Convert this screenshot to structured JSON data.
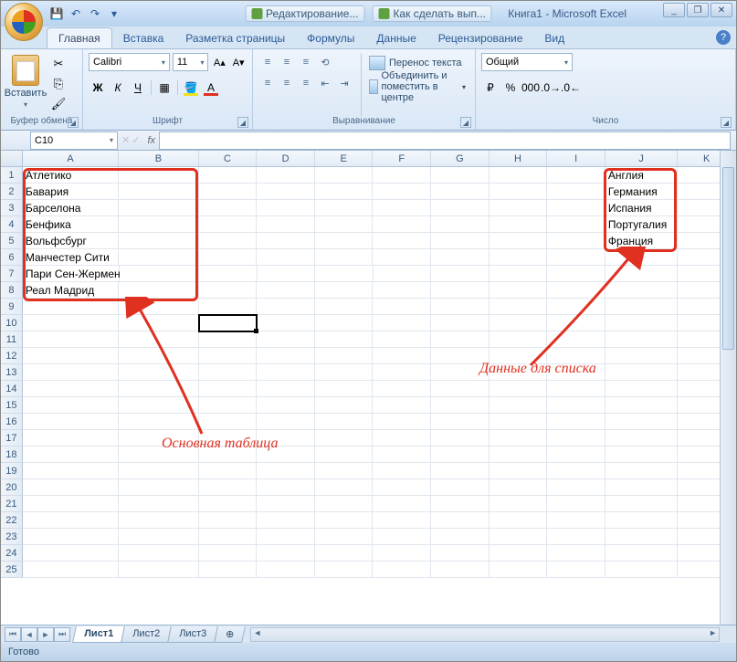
{
  "app_title": "Книга1 - Microsoft Excel",
  "qat": {
    "save": "💾",
    "undo": "↶",
    "redo": "↷",
    "more": "▾"
  },
  "browser_tabs": [
    {
      "label": "Редактирование..."
    },
    {
      "label": "Как сделать вып..."
    }
  ],
  "ribbon_tabs": [
    "Главная",
    "Вставка",
    "Разметка страницы",
    "Формулы",
    "Данные",
    "Рецензирование",
    "Вид"
  ],
  "active_tab_index": 0,
  "clipboard": {
    "paste": "Вставить",
    "group": "Буфер обмена"
  },
  "font": {
    "group": "Шрифт",
    "name": "Calibri",
    "size": "11",
    "bold": "Ж",
    "italic": "К",
    "underline": "Ч"
  },
  "align": {
    "group": "Выравнивание",
    "wrap": "Перенос текста",
    "merge": "Объединить и поместить в центре"
  },
  "number": {
    "group": "Число",
    "format": "Общий"
  },
  "name_box": "C10",
  "fx": "fx",
  "columns": [
    "A",
    "B",
    "C",
    "D",
    "E",
    "F",
    "G",
    "H",
    "I",
    "J",
    "K"
  ],
  "col_widths": {
    "A": 106,
    "B": 88,
    "C": 64,
    "D": 64,
    "E": 64,
    "F": 64,
    "G": 64,
    "H": 64,
    "I": 64,
    "J": 80,
    "K": 64
  },
  "visible_rows": 25,
  "selected_cell": {
    "row": 10,
    "col": "C"
  },
  "cells": {
    "A1": "Атлетико",
    "A2": "Бавария",
    "A3": "Барселона",
    "A4": "Бенфика",
    "A5": "Вольфсбург",
    "A6": "Манчестер Сити",
    "A7": "Пари Сен-Жермен",
    "A8": "Реал Мадрид",
    "J1": "Англия",
    "J2": "Германия",
    "J3": "Испания",
    "J4": "Португалия",
    "J5": "Франция"
  },
  "annotations": {
    "main_table": "Основная таблица",
    "list_data": "Данные для списка"
  },
  "sheets": [
    "Лист1",
    "Лист2",
    "Лист3"
  ],
  "active_sheet_index": 0,
  "status": "Готово",
  "colors": {
    "annotation": "#e03020"
  }
}
